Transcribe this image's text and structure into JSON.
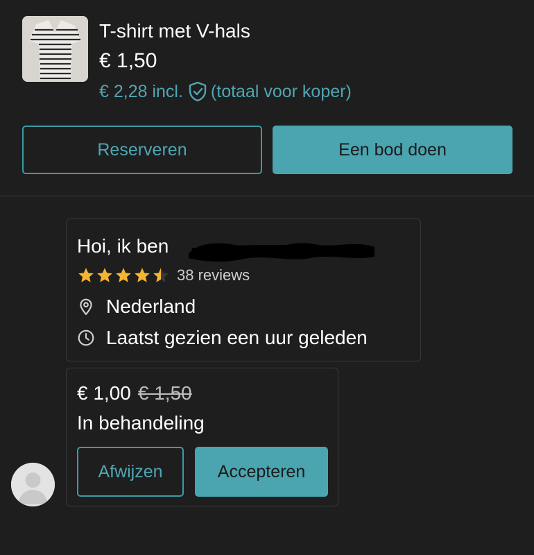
{
  "product": {
    "title": "T-shirt met V-hals",
    "price": "€ 1,50",
    "price_incl": "€ 2,28 incl.",
    "price_incl_note": "(totaal voor koper)",
    "shield_icon": "shield-check-icon",
    "thumbnail_icon": "tshirt-photo"
  },
  "actions": {
    "reserve_label": "Reserveren",
    "offer_label": "Een bod doen"
  },
  "seller": {
    "greeting": "Hoi, ik ben",
    "rating": 4.5,
    "reviews": "38 reviews",
    "location": "Nederland",
    "last_seen": "Laatst gezien een uur geleden",
    "location_icon": "location-pin-icon",
    "clock_icon": "clock-icon"
  },
  "offer": {
    "new_price": "€ 1,00",
    "old_price": "€ 1,50",
    "status": "In behandeling",
    "reject_label": "Afwijzen",
    "accept_label": "Accepteren"
  },
  "colors": {
    "background": "#1e1e1e",
    "accent": "#4aa5b0",
    "star": "#f5b531"
  }
}
